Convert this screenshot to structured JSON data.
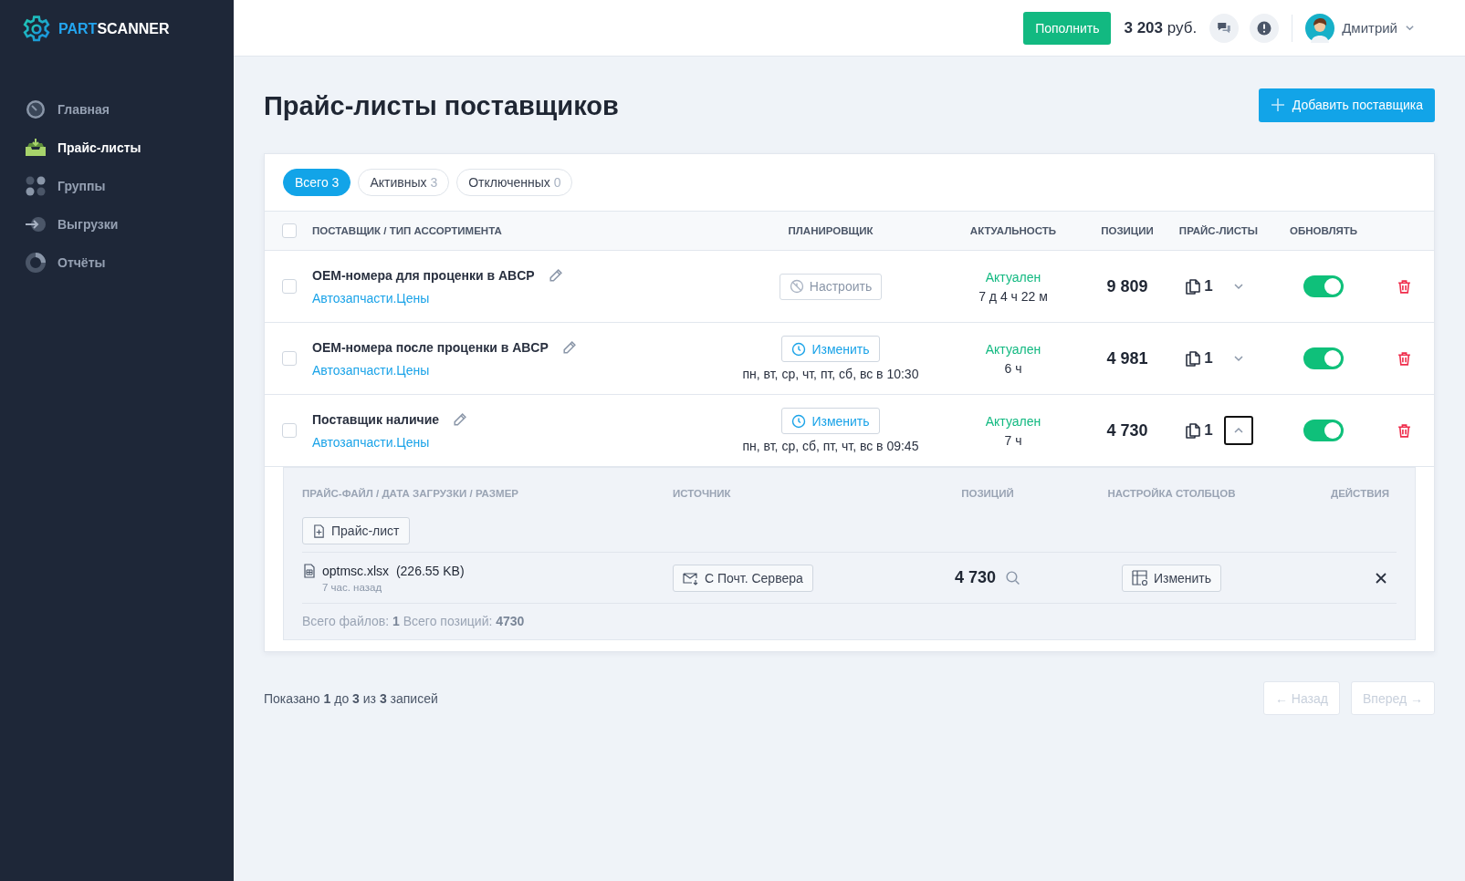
{
  "brand": {
    "part": "PART",
    "scanner": "SCANNER"
  },
  "nav": [
    {
      "label": "Главная",
      "kind": "gauge",
      "selected": false
    },
    {
      "label": "Прайс-листы",
      "kind": "inbox",
      "selected": true
    },
    {
      "label": "Группы",
      "kind": "dots",
      "selected": false
    },
    {
      "label": "Выгрузки",
      "kind": "export",
      "selected": false
    },
    {
      "label": "Отчёты",
      "kind": "pie",
      "selected": false
    }
  ],
  "header": {
    "topup": "Пополнить",
    "balance_amount": "3 203",
    "balance_currency": "руб.",
    "user": "Дмитрий"
  },
  "page": {
    "title": "Прайс-листы поставщиков",
    "add_button": "Добавить поставщика"
  },
  "filters": [
    {
      "label": "Всего",
      "count": "3",
      "selected": true
    },
    {
      "label": "Активных",
      "count": "3",
      "selected": false
    },
    {
      "label": "Отключенных",
      "count": "0",
      "selected": false
    }
  ],
  "table": {
    "select_all_checked": false,
    "columns": [
      "ПОСТАВЩИК / ТИП АССОРТИМЕНТА",
      "ПЛАНИРОВЩИК",
      "АКТУАЛЬНОСТЬ",
      "ПОЗИЦИИ",
      "ПРАЙС-ЛИСТЫ",
      "ОБНОВЛЯТЬ"
    ],
    "rows": [
      {
        "checked": false,
        "name": "OEM-номера для проценки в ABCP",
        "type": "Автозапчасти.Цены",
        "scheduler": {
          "kind": "configure",
          "label": "Настроить"
        },
        "status": "Актуален",
        "age": "7 д 4 ч 22 м",
        "positions": "9 809",
        "pricelists": "1",
        "expanded": false,
        "update_on": true
      },
      {
        "checked": false,
        "name": "OEM-номера после проценки в ABCP",
        "type": "Автозапчасти.Цены",
        "scheduler": {
          "kind": "change",
          "label": "Изменить",
          "schedule": "пн, вт, ср, чт, пт, сб, вс в 10:30"
        },
        "status": "Актуален",
        "age": "6 ч",
        "positions": "4 981",
        "pricelists": "1",
        "expanded": false,
        "update_on": true
      },
      {
        "checked": false,
        "name": "Поставщик наличие",
        "type": "Автозапчасти.Цены",
        "scheduler": {
          "kind": "change",
          "label": "Изменить",
          "schedule": "пн, вт, ср, сб, пт, чт, вс в 09:45"
        },
        "status": "Актуален",
        "age": "7 ч",
        "positions": "4 730",
        "pricelists": "1",
        "expanded": true,
        "update_on": true
      }
    ]
  },
  "details": {
    "columns": [
      "ПРАЙС-ФАЙЛ / ДАТА ЗАГРУЗКИ / РАЗМЕР",
      "ИСТОЧНИК",
      "ПОЗИЦИЙ",
      "НАСТРОЙКА СТОЛБЦОВ",
      "ДЕЙСТВИЯ"
    ],
    "upload_button": "Прайс-лист",
    "files": [
      {
        "name": "optmsc.xlsx",
        "size": "(226.55 KB)",
        "ago": "7 час. назад",
        "source": "С Почт. Сервера",
        "positions": "4 730",
        "settings_button": "Изменить"
      }
    ],
    "summary": "Всего файлов: **1** Всего позиций: **4730**"
  },
  "footer": {
    "info": "Показано **1** до **3** из **3** записей",
    "prev": "← Назад",
    "next": "Вперед →",
    "prev_disabled": true,
    "next_disabled": true
  }
}
